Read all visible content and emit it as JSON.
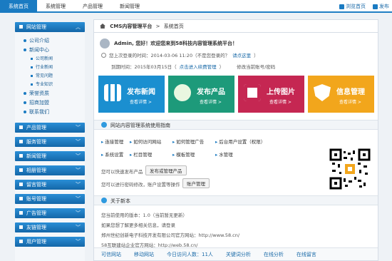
{
  "topnav": {
    "tabs": [
      "系统首页",
      "系统管理",
      "产品管理",
      "新闻管理"
    ],
    "right": [
      "浏览首页",
      "发布"
    ]
  },
  "sidebar": {
    "groups": [
      {
        "label": "网站管理",
        "expanded": true,
        "items": [
          {
            "label": "公司介绍"
          },
          {
            "label": "新闻中心",
            "children": [
              "公司新闻",
              "行业新闻",
              "常见问题",
              "专业知识"
            ]
          },
          {
            "label": "荣誉资质"
          },
          {
            "label": "招商加盟"
          },
          {
            "label": "联系我们"
          }
        ]
      },
      {
        "label": "产品管理"
      },
      {
        "label": "服务管理"
      },
      {
        "label": "新闻管理"
      },
      {
        "label": "相册管理"
      },
      {
        "label": "留言管理"
      },
      {
        "label": "账号管理"
      },
      {
        "label": "广告管理"
      },
      {
        "label": "友链管理"
      },
      {
        "label": "用户管理"
      }
    ]
  },
  "breadcrumb": {
    "root": "CMS内容管理平台",
    "sep": ">",
    "current": "系统首页"
  },
  "welcome": {
    "text": "Admin, 您好！欢迎您来到58科技内容管理系统平台！"
  },
  "info": {
    "last_login": "您上次登录的时间：2014-03-06 11:20（不是您登录的？",
    "last_login_link": "请点这里",
    "last_login_end": "）",
    "expire": "到期时间：2015年03月15日（",
    "expire_link": "点击进入续费管理",
    "expire_end": "）",
    "modify": "修改当前账号/密码"
  },
  "tiles": [
    {
      "label": "发布新闻",
      "sub": "查看详情 >",
      "color": "#1b8fd0",
      "icon": "grid-icon"
    },
    {
      "label": "发布产品",
      "sub": "查看详情 >",
      "color": "#1d9a7a",
      "icon": "box-icon"
    },
    {
      "label": "上传图片",
      "sub": "查看详情 >",
      "color": "#c52752",
      "icon": "camera-icon"
    },
    {
      "label": "信息管理",
      "sub": "查看详情 >",
      "color": "#f2a61c",
      "icon": "shield-icon"
    }
  ],
  "guide": {
    "title": "网站内容管理系统使用指南",
    "row1": [
      "连接管理",
      "如何访问网站",
      "如何管理广告",
      "后台用户设置（权限）"
    ],
    "row2": [
      "系统设置",
      "栏目管理",
      "模板管理",
      "水管理"
    ],
    "post_text": "您可以快速发布产品",
    "post_btn": "发布或管理产品",
    "account_text": "您可以进行密码修改，账户设置等操作",
    "account_btn": "账户管理"
  },
  "about": {
    "title": "关于新本",
    "lines": [
      "您当前使用的版本：1.0（当前暂无更新）",
      "如果您想了解更多相关信息，请登录",
      "郑州世纪创新电子科技开发有限公司官方网站：http://www.58.cn/",
      "58互联建站企业官方网站：http://web.58.cn/"
    ]
  },
  "footer": {
    "items": [
      "可信网站",
      "移动网站",
      "今日访问人数：11人",
      "关键词分析",
      "在线分析",
      "在线留言"
    ]
  }
}
